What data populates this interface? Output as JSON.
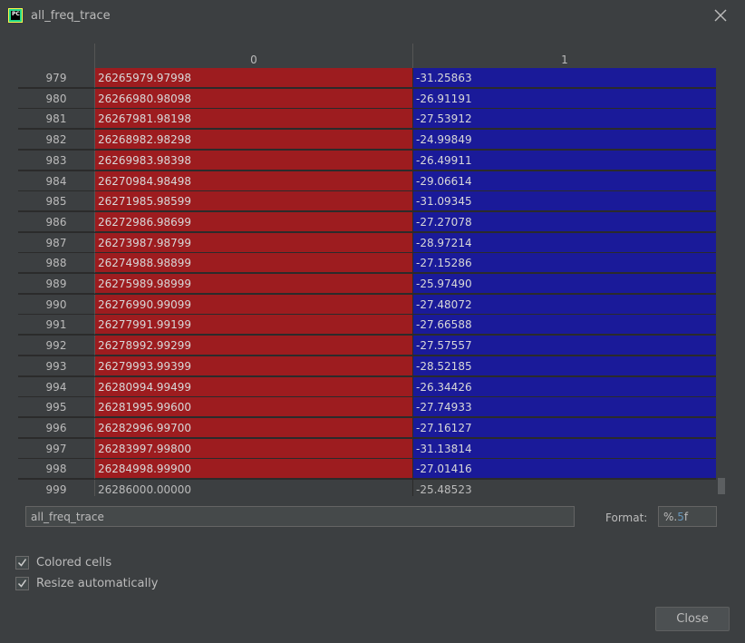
{
  "window": {
    "title": "all_freq_trace",
    "app_icon": "pycharm-icon"
  },
  "table": {
    "columns": [
      "0",
      "1"
    ],
    "rows": [
      {
        "index": "979",
        "c0": "26265979.97998",
        "c1": "-31.25863"
      },
      {
        "index": "980",
        "c0": "26266980.98098",
        "c1": "-26.91191"
      },
      {
        "index": "981",
        "c0": "26267981.98198",
        "c1": "-27.53912"
      },
      {
        "index": "982",
        "c0": "26268982.98298",
        "c1": "-24.99849"
      },
      {
        "index": "983",
        "c0": "26269983.98398",
        "c1": "-26.49911"
      },
      {
        "index": "984",
        "c0": "26270984.98498",
        "c1": "-29.06614"
      },
      {
        "index": "985",
        "c0": "26271985.98599",
        "c1": "-31.09345"
      },
      {
        "index": "986",
        "c0": "26272986.98699",
        "c1": "-27.27078"
      },
      {
        "index": "987",
        "c0": "26273987.98799",
        "c1": "-28.97214"
      },
      {
        "index": "988",
        "c0": "26274988.98899",
        "c1": "-27.15286"
      },
      {
        "index": "989",
        "c0": "26275989.98999",
        "c1": "-25.97490"
      },
      {
        "index": "990",
        "c0": "26276990.99099",
        "c1": "-27.48072"
      },
      {
        "index": "991",
        "c0": "26277991.99199",
        "c1": "-27.66588"
      },
      {
        "index": "992",
        "c0": "26278992.99299",
        "c1": "-27.57557"
      },
      {
        "index": "993",
        "c0": "26279993.99399",
        "c1": "-28.52185"
      },
      {
        "index": "994",
        "c0": "26280994.99499",
        "c1": "-26.34426"
      },
      {
        "index": "995",
        "c0": "26281995.99600",
        "c1": "-27.74933"
      },
      {
        "index": "996",
        "c0": "26282996.99700",
        "c1": "-27.16127"
      },
      {
        "index": "997",
        "c0": "26283997.99800",
        "c1": "-31.13814"
      },
      {
        "index": "998",
        "c0": "26284998.99900",
        "c1": "-27.01416"
      },
      {
        "index": "999",
        "c0": "26286000.00000",
        "c1": "-25.48523",
        "plain": true
      }
    ],
    "colors": {
      "col0": "#9d1c1f",
      "col1": "#1a1a99"
    }
  },
  "name_field": {
    "value": "all_freq_trace"
  },
  "format": {
    "label": "Format:",
    "prefix": "%.",
    "number": "5",
    "suffix": "f"
  },
  "options": {
    "colored_cells": {
      "label": "Colored cells",
      "checked": true
    },
    "resize_automatically": {
      "label": "Resize automatically",
      "checked": true
    }
  },
  "buttons": {
    "close_label": "Close"
  }
}
